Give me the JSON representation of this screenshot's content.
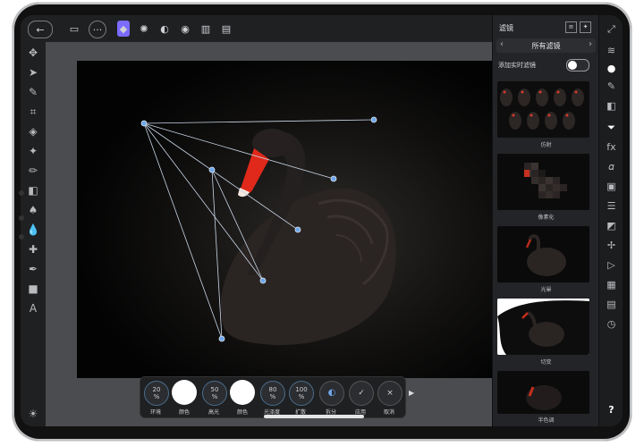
{
  "panel": {
    "title": "滤镜",
    "category": "所有滤镜",
    "live_toggle_label": "添加实时滤镜",
    "filters": [
      {
        "label": "仿射"
      },
      {
        "label": "像素化"
      },
      {
        "label": "光晕"
      },
      {
        "label": "切变"
      },
      {
        "label": "半色调"
      }
    ]
  },
  "bottom": {
    "controls": [
      {
        "value": "20",
        "unit": "%",
        "label": "环境"
      },
      {
        "value": "",
        "unit": "",
        "label": "颜色",
        "swatch": "#ffffff"
      },
      {
        "value": "50",
        "unit": "%",
        "label": "高光"
      },
      {
        "value": "",
        "unit": "",
        "label": "颜色",
        "swatch": "#ffffff"
      },
      {
        "value": "80",
        "unit": "%",
        "label": "光泽度"
      },
      {
        "value": "100",
        "unit": "%",
        "label": "扩散"
      },
      {
        "value": "",
        "unit": "",
        "label": "拆分"
      },
      {
        "value": "✓",
        "unit": "",
        "label": "应用"
      },
      {
        "value": "×",
        "unit": "",
        "label": "取消"
      }
    ]
  },
  "colors": {
    "accent": "#7b6cff",
    "handle": "#6ea6e8",
    "toggle": "#ffffff"
  },
  "help": "?"
}
